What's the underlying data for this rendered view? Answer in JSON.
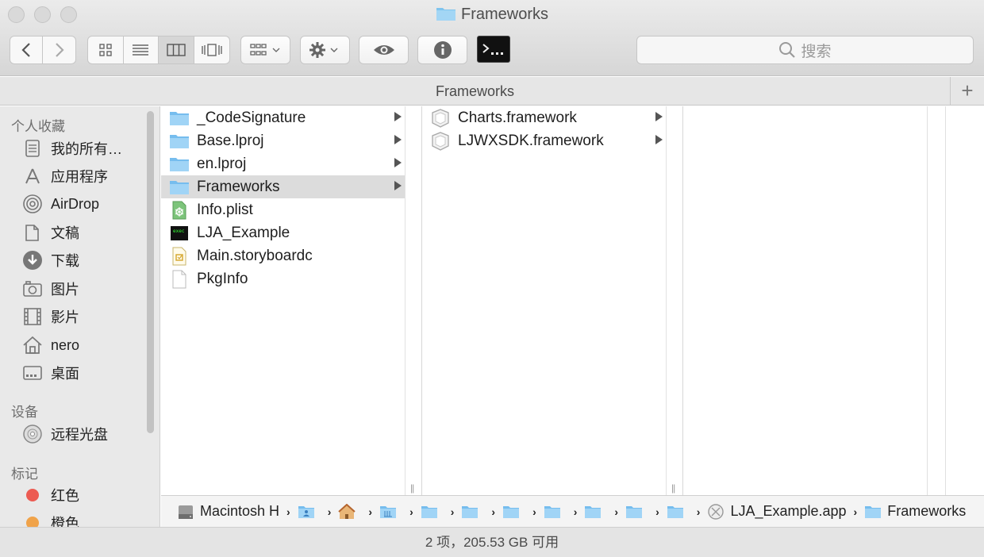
{
  "window": {
    "title": "Frameworks"
  },
  "toolbar": {
    "view_modes": [
      "icon-view",
      "list-view",
      "column-view",
      "cover-flow-view"
    ],
    "active_view": "column-view",
    "search_placeholder": "搜索"
  },
  "path_header": {
    "label": "Frameworks",
    "add_label": "+"
  },
  "sidebar": {
    "favorites_header": "个人收藏",
    "favorites": [
      {
        "label": "我的所有…",
        "icon": "all-files-icon"
      },
      {
        "label": "应用程序",
        "icon": "applications-icon"
      },
      {
        "label": "AirDrop",
        "icon": "airdrop-icon"
      },
      {
        "label": "文稿",
        "icon": "documents-icon"
      },
      {
        "label": "下载",
        "icon": "downloads-icon"
      },
      {
        "label": "图片",
        "icon": "pictures-icon"
      },
      {
        "label": "影片",
        "icon": "movies-icon"
      },
      {
        "label": "nero",
        "icon": "home-icon"
      },
      {
        "label": "桌面",
        "icon": "desktop-icon"
      }
    ],
    "devices_header": "设备",
    "devices": [
      {
        "label": "远程光盘",
        "icon": "disc-icon"
      }
    ],
    "tags_header": "标记",
    "tags": [
      {
        "label": "红色",
        "color": "#ec5b52"
      },
      {
        "label": "橙色",
        "color": "#f0a34a"
      }
    ]
  },
  "column1": [
    {
      "name": "_CodeSignature",
      "type": "folder",
      "has_children": true
    },
    {
      "name": "Base.lproj",
      "type": "folder",
      "has_children": true
    },
    {
      "name": "en.lproj",
      "type": "folder",
      "has_children": true
    },
    {
      "name": "Frameworks",
      "type": "folder",
      "has_children": true,
      "selected": true
    },
    {
      "name": "Info.plist",
      "type": "plist",
      "has_children": false
    },
    {
      "name": "LJA_Example",
      "type": "exec",
      "has_children": false
    },
    {
      "name": "Main.storyboardc",
      "type": "storyboard",
      "has_children": false
    },
    {
      "name": "PkgInfo",
      "type": "file",
      "has_children": false
    }
  ],
  "column2": [
    {
      "name": "Charts.framework",
      "type": "framework",
      "has_children": true
    },
    {
      "name": "LJWXSDK.framework",
      "type": "framework",
      "has_children": true
    }
  ],
  "pathbar": {
    "items": [
      {
        "label": "Macintosh H",
        "icon": "hard-disk-icon"
      },
      {
        "label": "",
        "icon": "user-folder-icon"
      },
      {
        "label": "",
        "icon": "home-icon"
      },
      {
        "label": "",
        "icon": "library-folder-icon"
      },
      {
        "label": "",
        "icon": "folder-icon"
      },
      {
        "label": "",
        "icon": "folder-icon"
      },
      {
        "label": "",
        "icon": "folder-icon"
      },
      {
        "label": "",
        "icon": "folder-icon"
      },
      {
        "label": "",
        "icon": "folder-icon"
      },
      {
        "label": "",
        "icon": "folder-icon"
      },
      {
        "label": "",
        "icon": "folder-icon"
      },
      {
        "label": "LJA_Example.app",
        "icon": "app-icon"
      },
      {
        "label": "Frameworks",
        "icon": "folder-icon"
      }
    ]
  },
  "status": {
    "text": "2 项，205.53 GB 可用"
  }
}
